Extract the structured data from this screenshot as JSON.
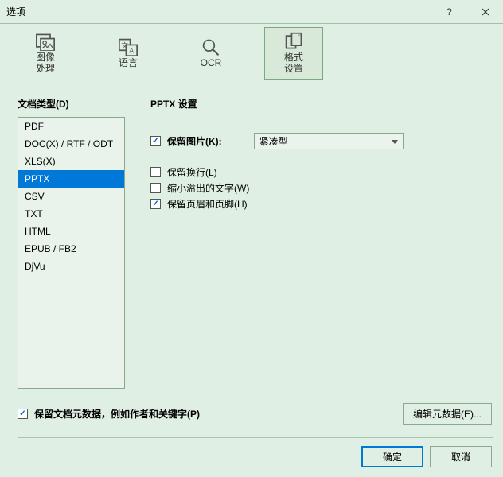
{
  "window": {
    "title": "选项"
  },
  "toolbar": {
    "items": [
      {
        "label": "图像\n处理",
        "name": "image-processing"
      },
      {
        "label": "语言",
        "name": "language"
      },
      {
        "label": "OCR",
        "name": "ocr"
      },
      {
        "label": "格式\n设置",
        "name": "format-settings"
      }
    ],
    "selected_index": 3
  },
  "left": {
    "title": "文档类型(D)",
    "items": [
      "PDF",
      "DOC(X) / RTF / ODT",
      "XLS(X)",
      "PPTX",
      "CSV",
      "TXT",
      "HTML",
      "EPUB / FB2",
      "DjVu"
    ],
    "selected_index": 3
  },
  "settings": {
    "title": "PPTX 设置",
    "keep_pictures": {
      "label": "保留图片(K):",
      "checked": true
    },
    "picture_mode": {
      "value": "紧凑型"
    },
    "options": [
      {
        "label": "保留换行(L)",
        "checked": false
      },
      {
        "label": "缩小溢出的文字(W)",
        "checked": false
      },
      {
        "label": "保留页眉和页脚(H)",
        "checked": true
      }
    ]
  },
  "footer": {
    "keep_metadata": {
      "label": "保留文档元数据，例如作者和关键字(P)",
      "checked": true
    },
    "edit_metadata": "编辑元数据(E)...",
    "ok": "确定",
    "cancel": "取消"
  }
}
